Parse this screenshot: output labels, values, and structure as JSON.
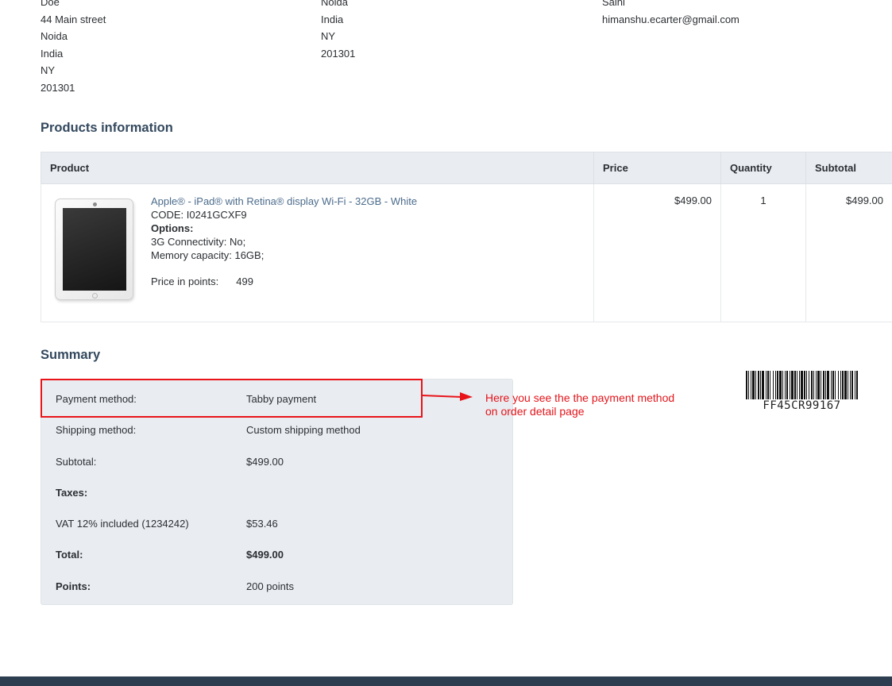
{
  "addresses": {
    "col1": [
      "Doe",
      "44 Main street",
      "Noida",
      "India",
      "NY",
      "201301"
    ],
    "col2": [
      "Noida",
      "India",
      "NY",
      "201301"
    ],
    "col3": [
      "Saini",
      "himanshu.ecarter@gmail.com"
    ]
  },
  "products": {
    "title": "Products information",
    "headers": {
      "product": "Product",
      "price": "Price",
      "quantity": "Quantity",
      "subtotal": "Subtotal"
    },
    "items": [
      {
        "name": "Apple® - iPad® with Retina® display Wi-Fi - 32GB - White",
        "code": "CODE: I0241GCXF9",
        "options_label": "Options:",
        "options": [
          "3G Connectivity: No;",
          "Memory capacity: 16GB;"
        ],
        "points_label": "Price in points:",
        "points_value": "499",
        "price": "$499.00",
        "quantity": "1",
        "subtotal": "$499.00",
        "image_icon": "ipad-image"
      }
    ]
  },
  "summary": {
    "title": "Summary",
    "payment_method": {
      "label": "Payment method:",
      "value": "Tabby payment"
    },
    "shipping_method": {
      "label": "Shipping method:",
      "value": "Custom shipping method"
    },
    "subtotal": {
      "label": "Subtotal:",
      "value": "$499.00"
    },
    "taxes": {
      "label": "Taxes:"
    },
    "vat": {
      "label": "VAT 12% included (1234242)",
      "value": "$53.46"
    },
    "total": {
      "label": "Total:",
      "value": "$499.00"
    },
    "points": {
      "label": "Points:",
      "value": "200 points"
    }
  },
  "annotation": {
    "lines": [
      "Here you see the the payment method",
      "on order detail page"
    ],
    "color": "#e3151b"
  },
  "barcode": {
    "text": "FF45CR99167"
  },
  "colors": {
    "heading": "#34495e",
    "link": "#4c6c8c",
    "table_header_bg": "#e9ecf0",
    "footer": "#2c3e50",
    "highlight": "#e8141a"
  }
}
